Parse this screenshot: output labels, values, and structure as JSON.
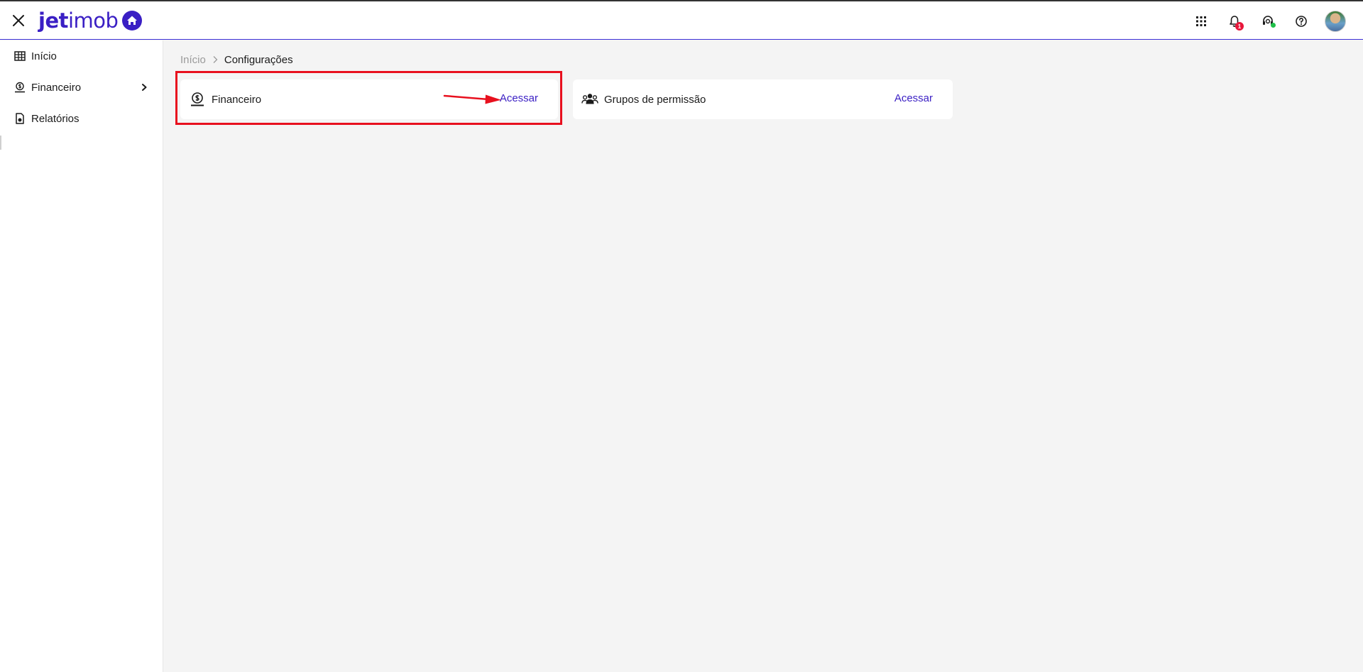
{
  "header": {
    "logo": {
      "bold_part": "jet",
      "light_part": "imob"
    },
    "notification_count": "1",
    "colors": {
      "brand": "#3a1fc4",
      "badge": "#e8173b",
      "online": "#20c04a"
    },
    "icons": [
      "close-icon",
      "apps-grid-icon",
      "bell-icon",
      "support-headset-icon",
      "help-icon",
      "avatar"
    ]
  },
  "sidebar": {
    "items": [
      {
        "label": "Início",
        "icon": "table-icon"
      },
      {
        "label": "Financeiro",
        "icon": "money-hand-icon",
        "has_submenu": true
      },
      {
        "label": "Relatórios",
        "icon": "report-file-icon"
      }
    ]
  },
  "breadcrumb": {
    "home": "Início",
    "current": "Configurações"
  },
  "cards": [
    {
      "title": "Financeiro",
      "link": "Acessar",
      "icon": "money-hand-icon",
      "highlighted": true
    },
    {
      "title": "Grupos de permissão",
      "link": "Acessar",
      "icon": "users-group-icon"
    }
  ],
  "annotation": {
    "highlight_color": "#e8101e"
  }
}
